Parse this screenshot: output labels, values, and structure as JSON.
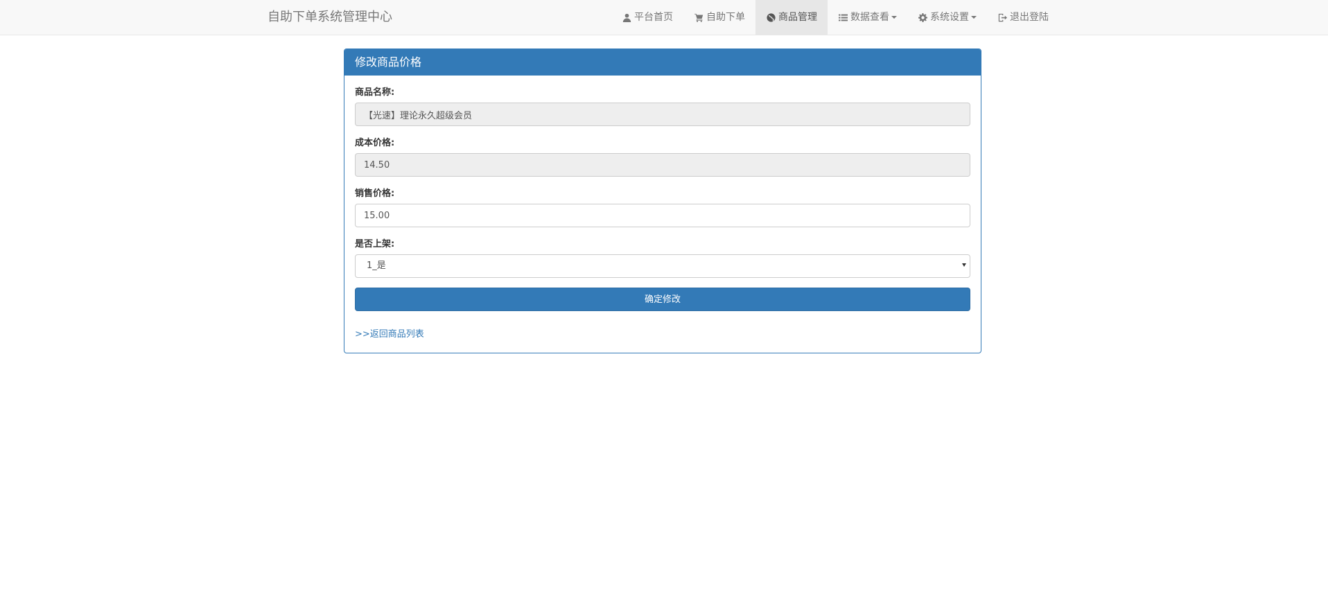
{
  "navbar": {
    "brand": "自助下单系统管理中心",
    "items": [
      {
        "label": "平台首页",
        "icon": "user-icon",
        "active": false,
        "dropdown": false
      },
      {
        "label": "自助下单",
        "icon": "shopping-cart-icon",
        "active": false,
        "dropdown": false
      },
      {
        "label": "商品管理",
        "icon": "globe-icon",
        "active": true,
        "dropdown": false
      },
      {
        "label": "数据查看",
        "icon": "list-icon",
        "active": false,
        "dropdown": true
      },
      {
        "label": "系统设置",
        "icon": "gear-icon",
        "active": false,
        "dropdown": true
      },
      {
        "label": "退出登陆",
        "icon": "logout-icon",
        "active": false,
        "dropdown": false
      }
    ]
  },
  "panel": {
    "title": "修改商品价格",
    "fields": {
      "name_label": "商品名称:",
      "name_value": "【光速】理论永久超级会员",
      "cost_label": "成本价格:",
      "cost_value": "14.50",
      "price_label": "销售价格:",
      "price_value": "15.00",
      "listed_label": "是否上架:",
      "listed_value": "1_是"
    },
    "submit_label": "确定修改",
    "back_link": ">>返回商品列表"
  },
  "colors": {
    "primary": "#337ab7",
    "navbar_bg": "#f8f8f8",
    "readonly_bg": "#eeeeee"
  }
}
